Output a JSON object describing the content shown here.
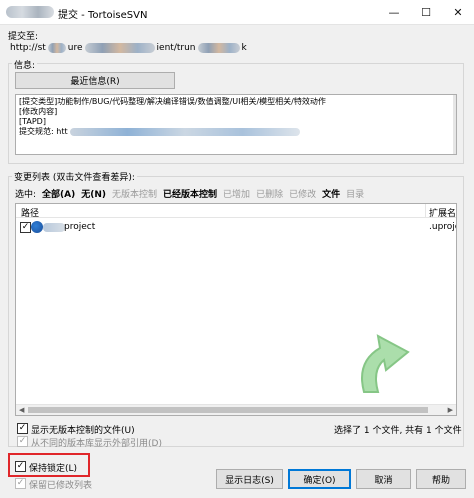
{
  "window": {
    "title": "提交 - TortoiseSVN",
    "controls": {
      "minimize": "—",
      "maximize": "☐",
      "close": "✕"
    }
  },
  "commit_to": {
    "label": "提交至:",
    "url_parts": [
      "http://st",
      "ure",
      "ient/trun",
      "k"
    ]
  },
  "message": {
    "group_label": "信息:",
    "recent_button": "最近信息(R)",
    "lines": [
      "[提交类型]功能制作/BUG/代码整理/解决编译错误/数值调整/UI相关/模型相关/特效动作",
      "[修改内容]",
      "[TAPD]"
    ],
    "submit_spec_label": "提交规范:",
    "submit_spec_value": "htt"
  },
  "changes": {
    "group_label": "变更列表 (双击文件查看差异):",
    "select_label": "选中:",
    "filters": [
      {
        "label": "全部(A)",
        "active": true
      },
      {
        "label": "无(N)",
        "active": true
      },
      {
        "label": "无版本控制",
        "active": false
      },
      {
        "label": "已经版本控制",
        "active": true
      },
      {
        "label": "已增加",
        "active": false
      },
      {
        "label": "已删除",
        "active": false
      },
      {
        "label": "已修改",
        "active": false
      },
      {
        "label": "文件",
        "active": true
      },
      {
        "label": "目录",
        "active": false
      }
    ],
    "columns": {
      "path": "路径",
      "extension": "扩展名"
    },
    "rows": [
      {
        "name_suffix": "project",
        "extension": ".uproject",
        "checked": true
      }
    ],
    "show_unversioned": "显示无版本控制的文件(U)",
    "show_externals": "从不同的版本库显示外部引用(D)",
    "selection_status": "选择了 1 个文件, 共有 1 个文件"
  },
  "options": {
    "keep_locks": "保持锁定(L)",
    "keep_changelists": "保留已修改列表"
  },
  "buttons": {
    "show_log": "显示日志(S)",
    "ok": "确定(O)",
    "cancel": "取消",
    "help": "帮助"
  },
  "icons": {
    "window_icon": "blurred-app-icon",
    "file_icon": "ue-project-icon",
    "watermark": "green-arrow-icon"
  },
  "colors": {
    "highlight_box": "#e0262a",
    "accent": "#0078d7",
    "watermark_green": "#7bc97b"
  }
}
